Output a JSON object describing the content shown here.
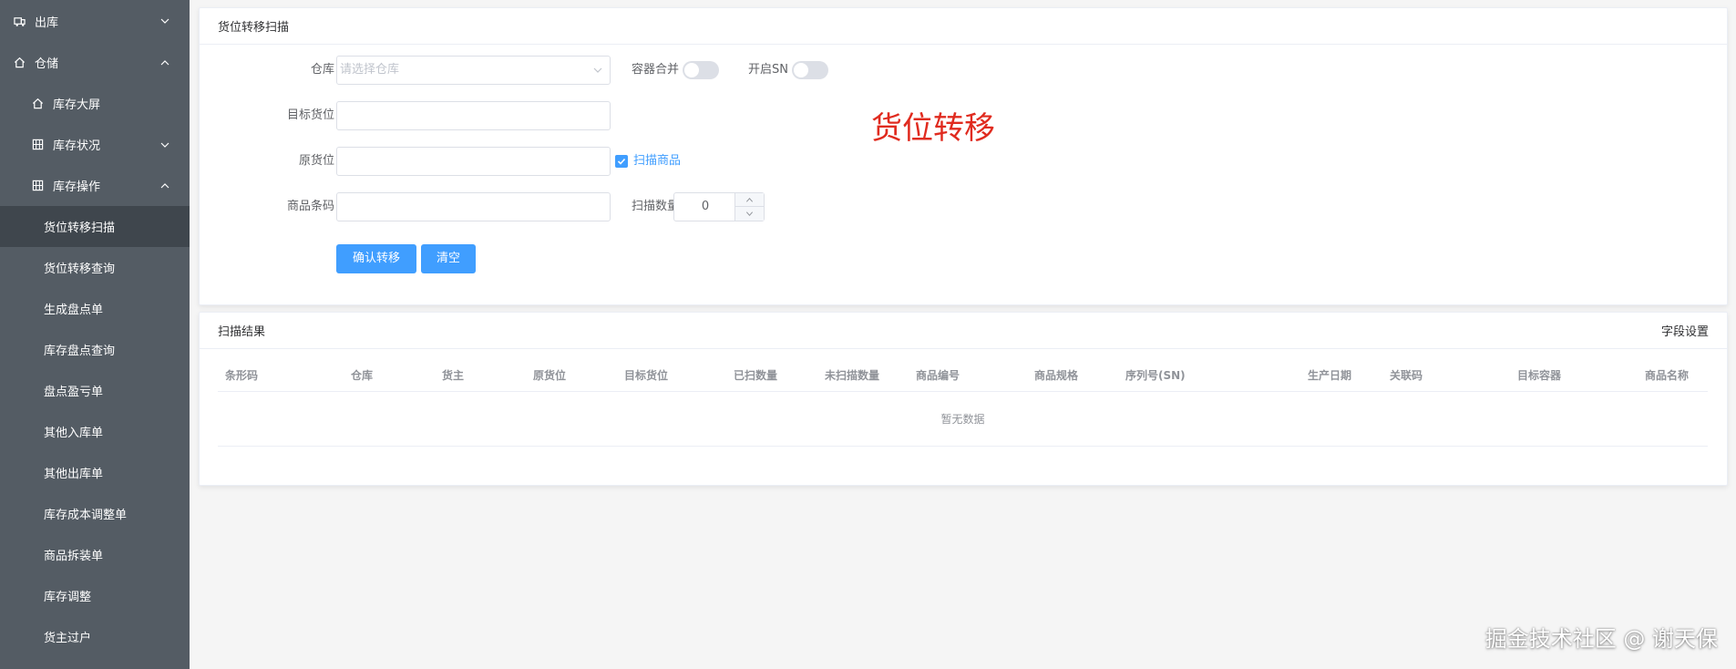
{
  "sidebar": {
    "items": [
      {
        "label": "出库",
        "icon": "truck-icon",
        "arrow": "down"
      },
      {
        "label": "仓储",
        "icon": "home-icon",
        "arrow": "up"
      },
      {
        "label": "库存大屏",
        "icon": "home-icon"
      },
      {
        "label": "库存状况",
        "icon": "grid-icon",
        "arrow": "down"
      },
      {
        "label": "库存操作",
        "icon": "grid-icon",
        "arrow": "up"
      },
      {
        "label": "货位转移扫描",
        "active": true
      },
      {
        "label": "货位转移查询"
      },
      {
        "label": "生成盘点单"
      },
      {
        "label": "库存盘点查询"
      },
      {
        "label": "盘点盈亏单"
      },
      {
        "label": "其他入库单"
      },
      {
        "label": "其他出库单"
      },
      {
        "label": "库存成本调整单"
      },
      {
        "label": "商品拆装单"
      },
      {
        "label": "库存调整"
      },
      {
        "label": "货主过户"
      }
    ]
  },
  "scan_card": {
    "title": "货位转移扫描",
    "warehouse_label": "仓库",
    "warehouse_placeholder": "请选择仓库",
    "container_merge_label": "容器合并",
    "enable_sn_label": "开启SN",
    "target_location_label": "目标货位",
    "source_location_label": "原货位",
    "scan_goods_label": "扫描商品",
    "barcode_label": "商品条码",
    "scan_qty_label": "扫描数量",
    "scan_qty_value": "0",
    "confirm_button": "确认转移",
    "clear_button": "清空",
    "big_title": "货位转移"
  },
  "result_card": {
    "title": "扫描结果",
    "field_settings": "字段设置",
    "columns": [
      "条形码",
      "仓库",
      "货主",
      "原货位",
      "目标货位",
      "已扫数量",
      "未扫描数量",
      "商品编号",
      "商品规格",
      "序列号(SN)",
      "生产日期",
      "关联码",
      "目标容器",
      "商品名称"
    ],
    "empty_text": "暂无数据"
  },
  "watermark": "掘金技术社区 @ 谢天保",
  "colors": {
    "sidebar_bg": "#545c64",
    "sidebar_active_bg": "#3f464d",
    "primary": "#409eff",
    "title_red": "#e02b1f"
  }
}
